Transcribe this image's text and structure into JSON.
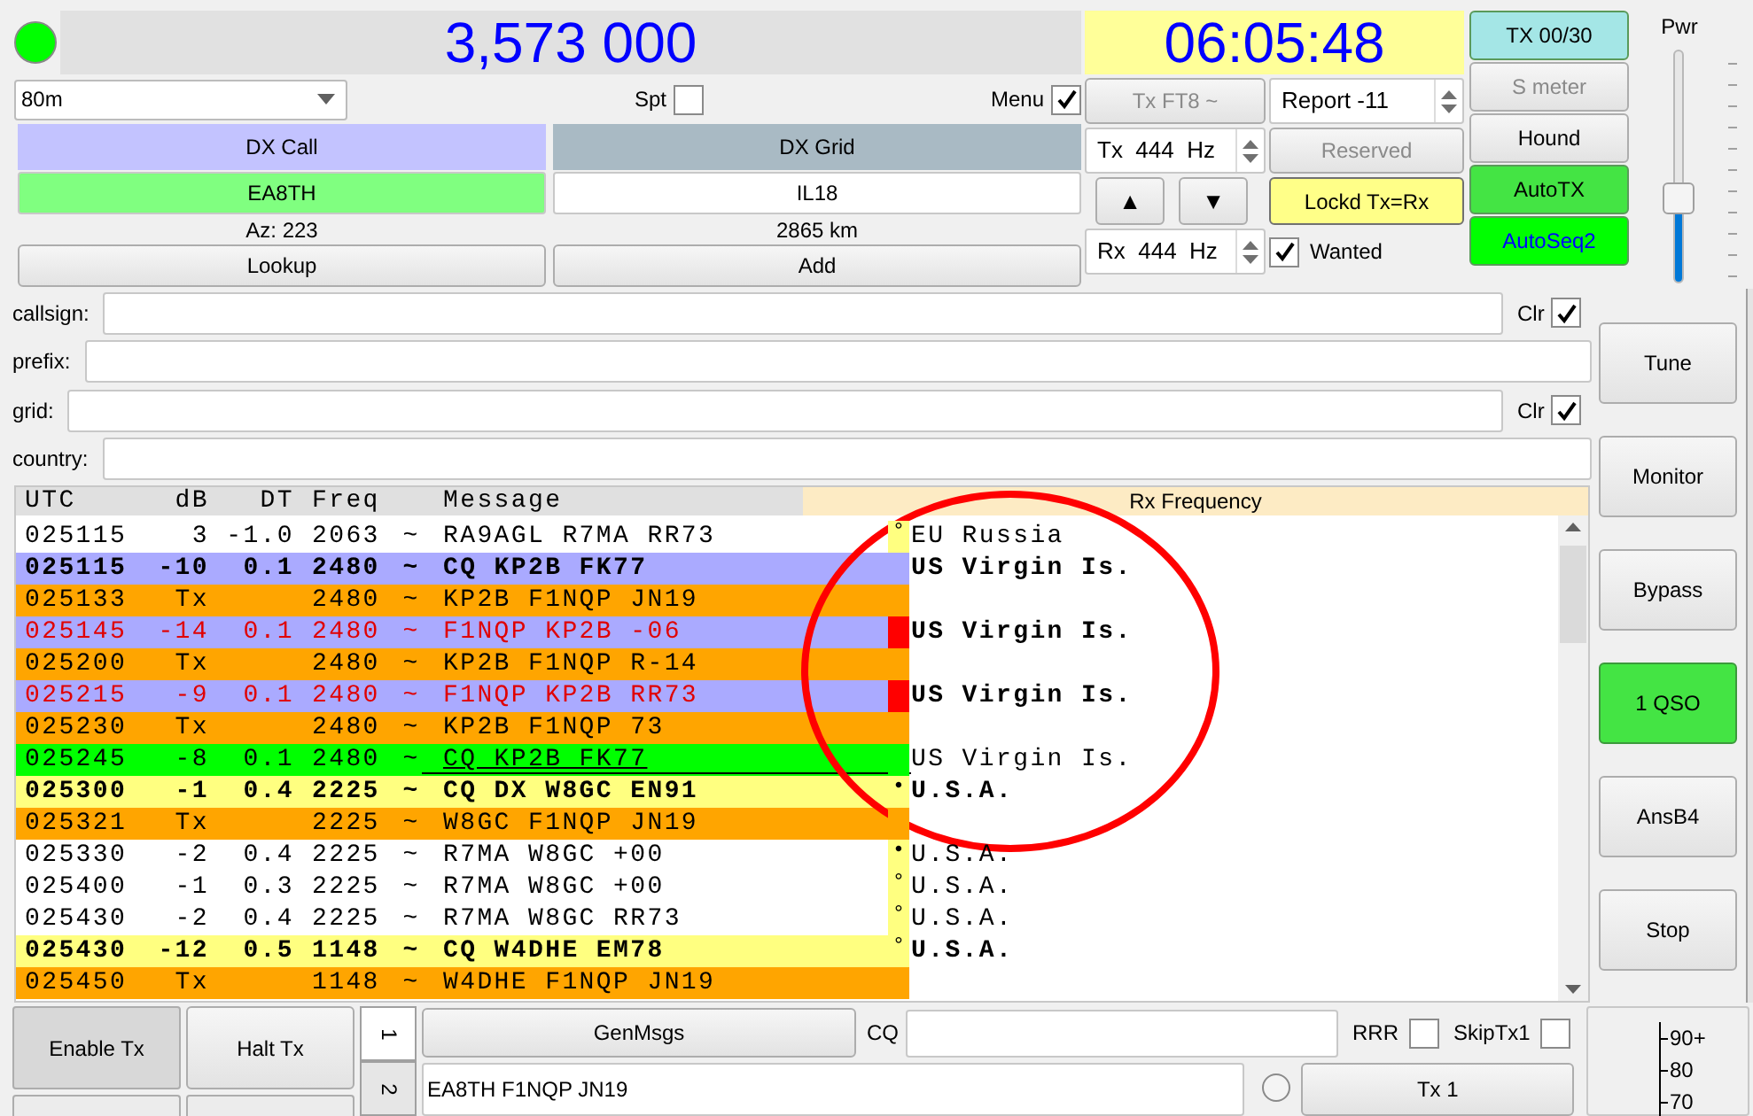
{
  "status_led": {
    "on": true
  },
  "frequency": "3,573 000",
  "band": "80m",
  "spt": {
    "label": "Spt",
    "checked": false
  },
  "menu": {
    "label": "Menu",
    "checked": true
  },
  "dx_call": {
    "label": "DX Call",
    "value": "EA8TH",
    "info": "Az: 223",
    "button": "Lookup"
  },
  "dx_grid": {
    "label": "DX Grid",
    "value": "IL18",
    "info": "2865 km",
    "button": "Add"
  },
  "clock": "06:05:48",
  "mode_button": {
    "label": "Tx FT8 ~",
    "disabled": true
  },
  "report": "Report -11",
  "tx_freq": "Tx  444  Hz",
  "rx_freq": "Rx  444  Hz",
  "reserved": {
    "label": "Reserved",
    "disabled": true
  },
  "arrows": [
    "▲",
    "▼"
  ],
  "lock": {
    "label": "Lockd Tx=Rx",
    "color": "#ffff88"
  },
  "wanted": {
    "label": "Wanted",
    "checked": true
  },
  "side_buttons": [
    {
      "label": "TX 00/30",
      "color": "#a4e6e6",
      "disabled": false
    },
    {
      "label": "S meter",
      "disabled": true
    },
    {
      "label": "Hound",
      "disabled": false
    },
    {
      "label": "AutoTX",
      "color": "#44e444",
      "disabled": false
    },
    {
      "label": "AutoSeq2",
      "color": "#00ff00",
      "highlight": true,
      "disabled": false
    }
  ],
  "power": {
    "label": "Pwr",
    "level": 0.36
  },
  "filters": [
    {
      "label": "callsign:",
      "clear": {
        "label": "Clr",
        "checked": true
      }
    },
    {
      "label": "prefix:"
    },
    {
      "label": "grid:",
      "clear": {
        "label": "Clr",
        "checked": true
      }
    },
    {
      "label": "country:"
    }
  ],
  "right_buttons": [
    {
      "label": "Tune",
      "on": false
    },
    {
      "label": "Monitor",
      "on": false
    },
    {
      "label": "Bypass",
      "on": false
    },
    {
      "label": "1 QSO",
      "on": true
    },
    {
      "label": "AnsB4",
      "on": false
    },
    {
      "label": "Stop",
      "on": false
    }
  ],
  "decodes": {
    "columns": [
      "UTC",
      "dB",
      "DT",
      "Freq",
      "Message"
    ],
    "rx_header": "Rx Frequency",
    "rows": [
      {
        "kind": "decode",
        "utc": "025115",
        "db": "3",
        "dt": "-1.0",
        "freq": "2063",
        "sep": "~",
        "message": "RA9AGL R7MA RR73",
        "color": "#ffffff",
        "marker": {
          "symbol": "°",
          "color": "#ffff80"
        },
        "country": "EU Russia"
      },
      {
        "kind": "cq",
        "utc": "025115",
        "db": "-10",
        "dt": "0.1",
        "freq": "2480",
        "sep": "~",
        "message": "CQ KP2B FK77",
        "color": "#aaaaff",
        "marker": {
          "color": "#aaaaff"
        },
        "country": "US Virgin Is."
      },
      {
        "kind": "tx",
        "utc": "025133",
        "db": "Tx",
        "freq": "2480",
        "sep": "~",
        "message": "KP2B F1NQP JN19",
        "color": "#ffa500",
        "marker": {
          "color": "#ffa500"
        }
      },
      {
        "kind": "to_me",
        "utc": "025145",
        "db": "-14",
        "dt": "0.1",
        "freq": "2480",
        "sep": "~",
        "message": "F1NQP KP2B -06",
        "color": "#aaaaff",
        "marker": {
          "color": "#ff0000"
        },
        "country": "US Virgin Is."
      },
      {
        "kind": "tx",
        "utc": "025200",
        "db": "Tx",
        "freq": "2480",
        "sep": "~",
        "message": "KP2B F1NQP R-14",
        "color": "#ffa500",
        "marker": {
          "color": "#ffa500"
        }
      },
      {
        "kind": "to_me",
        "utc": "025215",
        "db": "-9",
        "dt": "0.1",
        "freq": "2480",
        "sep": "~",
        "message": "F1NQP KP2B RR73",
        "color": "#aaaaff",
        "marker": {
          "color": "#ff0000"
        },
        "country": "US Virgin Is."
      },
      {
        "kind": "tx",
        "utc": "025230",
        "db": "Tx",
        "freq": "2480",
        "sep": "~",
        "message": "KP2B F1NQP 73",
        "color": "#ffa500",
        "marker": {
          "color": "#ffa500"
        }
      },
      {
        "kind": "logged",
        "utc": "025245",
        "db": "-8",
        "dt": "0.1",
        "freq": "2480",
        "sep": "~",
        "message": "CQ KP2B FK77",
        "color": "#00ff00",
        "marker": {
          "color": "#00ff00"
        },
        "country": "US Virgin Is."
      },
      {
        "kind": "cq",
        "utc": "025300",
        "db": "-1",
        "dt": "0.4",
        "freq": "2225",
        "sep": "~",
        "message": "CQ DX W8GC EN91",
        "color": "#ffff80",
        "marker": {
          "symbol": "•",
          "color": "#ffff80"
        },
        "country": "U.S.A."
      },
      {
        "kind": "tx",
        "utc": "025321",
        "db": "Tx",
        "freq": "2225",
        "sep": "~",
        "message": "W8GC F1NQP JN19",
        "color": "#ffa500",
        "marker": {
          "color": "#ffa500"
        }
      },
      {
        "kind": "decode",
        "utc": "025330",
        "db": "-2",
        "dt": "0.4",
        "freq": "2225",
        "sep": "~",
        "message": "R7MA W8GC +00",
        "color": "#ffffff",
        "marker": {
          "symbol": "•",
          "color": "#ffff80"
        },
        "country": "U.S.A."
      },
      {
        "kind": "decode",
        "utc": "025400",
        "db": "-1",
        "dt": "0.3",
        "freq": "2225",
        "sep": "~",
        "message": "R7MA W8GC +00",
        "color": "#ffffff",
        "marker": {
          "symbol": "°",
          "color": "#ffff80"
        },
        "country": "U.S.A."
      },
      {
        "kind": "decode",
        "utc": "025430",
        "db": "-2",
        "dt": "0.4",
        "freq": "2225",
        "sep": "~",
        "message": "R7MA W8GC RR73",
        "color": "#ffffff",
        "marker": {
          "symbol": "°",
          "color": "#ffff80"
        },
        "country": "U.S.A."
      },
      {
        "kind": "cq",
        "utc": "025430",
        "db": "-12",
        "dt": "0.5",
        "freq": "1148",
        "sep": "~",
        "message": "CQ W4DHE EM78",
        "color": "#ffff80",
        "marker": {
          "symbol": "°",
          "color": "#ffff80"
        },
        "country": "U.S.A."
      },
      {
        "kind": "tx",
        "utc": "025450",
        "db": "Tx",
        "freq": "1148",
        "sep": "~",
        "message": "W4DHE F1NQP JN19",
        "color": "#ffa500",
        "marker": {
          "color": "#ffa500"
        }
      }
    ]
  },
  "bottom": {
    "enable_tx": {
      "label": "Enable Tx",
      "pressed": true
    },
    "halt_tx": "Halt Tx",
    "tabs": [
      {
        "label": "1",
        "selected": true
      },
      {
        "label": "2",
        "selected": false
      }
    ],
    "gen_msgs": "GenMsgs",
    "cq_label": "CQ",
    "rrr": {
      "label": "RRR",
      "checked": false
    },
    "skip_tx1": {
      "label": "SkipTx1",
      "checked": false
    },
    "tx1_message": "EA8TH F1NQP JN19",
    "tx1_radio": {
      "selected": false
    },
    "tx1_button": "Tx 1"
  },
  "meter_scale": [
    "90+",
    "80",
    "70"
  ]
}
